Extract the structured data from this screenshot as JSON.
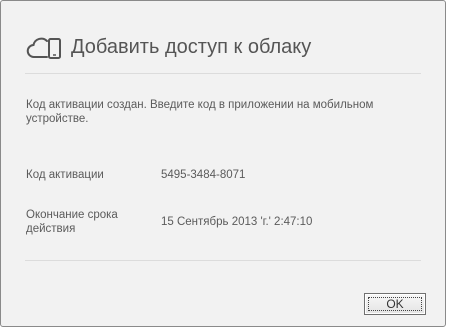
{
  "dialog": {
    "title": "Добавить доступ к облаку",
    "icon": "cloud-device-icon",
    "message": "Код активации создан. Введите код в приложении на мобильном устройстве.",
    "activation_code": {
      "label": "Код активации",
      "value": "5495-3484-8071"
    },
    "expiration": {
      "label": "Окончание срока действия",
      "value": "15 Сентябрь 2013 'г.' 2:47:10"
    },
    "ok_label": "OK"
  },
  "colors": {
    "dialog_background": "#f2f2f2",
    "text": "#5b5b5b",
    "title": "#555555"
  }
}
